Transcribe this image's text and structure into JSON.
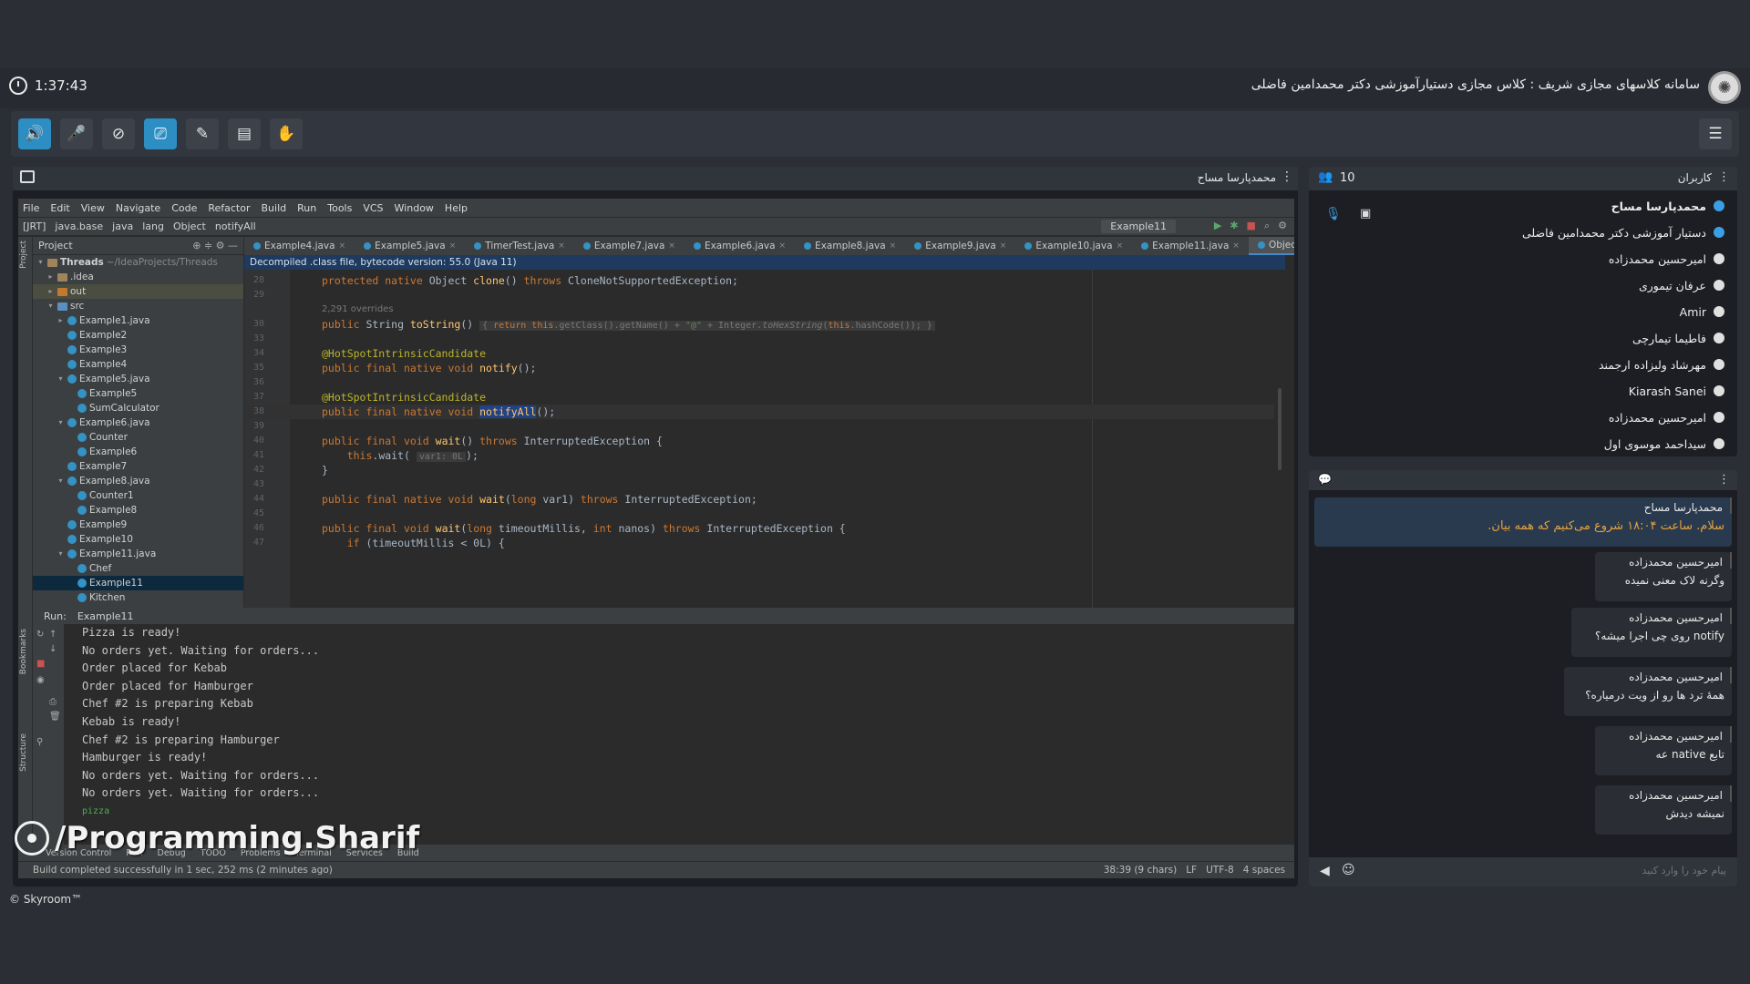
{
  "header": {
    "clock": "1:37:43",
    "room_title": "سامانه کلاسهای مجازی شریف : کلاس مجازی دستیارآموزشی دکتر محمدامین فاضلی"
  },
  "presenter": {
    "name": "محمدپارسا مساح"
  },
  "ide": {
    "menu": [
      "File",
      "Edit",
      "View",
      "Navigate",
      "Code",
      "Refactor",
      "Build",
      "Run",
      "Tools",
      "VCS",
      "Window",
      "Help"
    ],
    "breadcrumb": [
      "[JRT]",
      "java.base",
      "java",
      "lang",
      "Object",
      "notifyAll"
    ],
    "run_config": "Example11",
    "project_label": "Project",
    "tree": [
      {
        "label": "Threads",
        "extra": "~/IdeaProjects/Threads",
        "indent": 0,
        "arrow": "v",
        "icon": "fold"
      },
      {
        "label": ".idea",
        "indent": 1,
        "arrow": ">",
        "icon": "fold"
      },
      {
        "label": "out",
        "indent": 1,
        "arrow": ">",
        "icon": "fold-orange",
        "hl": true
      },
      {
        "label": "src",
        "indent": 1,
        "arrow": "v",
        "icon": "fold-blue"
      },
      {
        "label": "Example1.java",
        "indent": 2,
        "arrow": ">",
        "icon": "cls"
      },
      {
        "label": "Example2",
        "indent": 2,
        "arrow": "",
        "icon": "cls"
      },
      {
        "label": "Example3",
        "indent": 2,
        "arrow": "",
        "icon": "cls"
      },
      {
        "label": "Example4",
        "indent": 2,
        "arrow": "",
        "icon": "cls"
      },
      {
        "label": "Example5.java",
        "indent": 2,
        "arrow": "v",
        "icon": "cls"
      },
      {
        "label": "Example5",
        "indent": 3,
        "arrow": "",
        "icon": "cls"
      },
      {
        "label": "SumCalculator",
        "indent": 3,
        "arrow": "",
        "icon": "cls"
      },
      {
        "label": "Example6.java",
        "indent": 2,
        "arrow": "v",
        "icon": "cls"
      },
      {
        "label": "Counter",
        "indent": 3,
        "arrow": "",
        "icon": "cls"
      },
      {
        "label": "Example6",
        "indent": 3,
        "arrow": "",
        "icon": "cls"
      },
      {
        "label": "Example7",
        "indent": 2,
        "arrow": "",
        "icon": "cls"
      },
      {
        "label": "Example8.java",
        "indent": 2,
        "arrow": "v",
        "icon": "cls"
      },
      {
        "label": "Counter1",
        "indent": 3,
        "arrow": "",
        "icon": "cls"
      },
      {
        "label": "Example8",
        "indent": 3,
        "arrow": "",
        "icon": "cls"
      },
      {
        "label": "Example9",
        "indent": 2,
        "arrow": "",
        "icon": "cls"
      },
      {
        "label": "Example10",
        "indent": 2,
        "arrow": "",
        "icon": "cls"
      },
      {
        "label": "Example11.java",
        "indent": 2,
        "arrow": "v",
        "icon": "cls"
      },
      {
        "label": "Chef",
        "indent": 3,
        "arrow": "",
        "icon": "cls"
      },
      {
        "label": "Example11",
        "indent": 3,
        "arrow": "",
        "icon": "cls",
        "sel": true
      },
      {
        "label": "Kitchen",
        "indent": 3,
        "arrow": "",
        "icon": "cls"
      }
    ],
    "tabs": [
      "Example4.java",
      "Example5.java",
      "TimerTest.java",
      "Example7.java",
      "Example6.java",
      "Example8.java",
      "Example9.java",
      "Example10.java",
      "Example11.java",
      "Object.class"
    ],
    "active_tab": "Object.class",
    "banner": "Decompiled .class file, bytecode version: 55.0 (Java 11)",
    "overrides_hint": "2,291 overrides",
    "code_lines": [
      {
        "n": "28",
        "html": "<span class=\"kw\">protected native</span> Object <span class=\"fn\">clone</span>() <span class=\"kw\">throws</span> CloneNotSupportedException;"
      },
      {
        "n": "29",
        "html": ""
      },
      {
        "n": "30",
        "html": "<span class=\"kw\">public</span> String <span class=\"fn\">toString</span>() <span class=\"hint\">{ <span class=\"kw\">return this</span>.getClass().getName() + <span class=\"str\">\"@\"</span> + Integer.<span class=\"it\">toHexString</span>(<span class=\"kw\">this</span>.hashCode()); }</span>"
      },
      {
        "n": "33",
        "html": ""
      },
      {
        "n": "34",
        "html": "<span class=\"an\">@HotSpotIntrinsicCandidate</span>"
      },
      {
        "n": "35",
        "html": "<span class=\"kw\">public final native void</span> <span class=\"fn\">notify</span>();"
      },
      {
        "n": "36",
        "html": ""
      },
      {
        "n": "37",
        "html": "<span class=\"an\">@HotSpotIntrinsicCandidate</span>"
      },
      {
        "n": "38",
        "html": "<span class=\"kw\">public final native void</span> <span class=\"fn selw\">notifyAll</span>();"
      },
      {
        "n": "39",
        "html": ""
      },
      {
        "n": "40",
        "html": "<span class=\"kw\">public final void</span> <span class=\"fn\">wait</span>() <span class=\"kw\">throws</span> InterruptedException {"
      },
      {
        "n": "41",
        "html": "    <span class=\"kw\">this</span>.wait( <span class=\"hint\">var1: 0L</span>);"
      },
      {
        "n": "42",
        "html": "}"
      },
      {
        "n": "43",
        "html": ""
      },
      {
        "n": "44",
        "html": "<span class=\"kw\">public final native void</span> <span class=\"fn\">wait</span>(<span class=\"kw\">long</span> var1) <span class=\"kw\">throws</span> InterruptedException;"
      },
      {
        "n": "45",
        "html": ""
      },
      {
        "n": "46",
        "html": "<span class=\"kw\">public final void</span> <span class=\"fn\">wait</span>(<span class=\"kw\">long</span> timeoutMillis, <span class=\"kw\">int</span> nanos) <span class=\"kw\">throws</span> InterruptedException {"
      },
      {
        "n": "47",
        "html": "    <span class=\"kw\">if</span> (timeoutMillis < 0L) {"
      }
    ],
    "run_label": "Run:",
    "run_tab": "Example11",
    "console": [
      "Pizza is ready!",
      "No orders yet. Waiting for orders...",
      "Order placed for Kebab",
      "Order placed for Hamburger",
      "Chef #2 is preparing Kebab",
      "Kebab is ready!",
      "Chef #2 is preparing Hamburger",
      "Hamburger is ready!",
      "No orders yet. Waiting for orders...",
      "No orders yet. Waiting for orders..."
    ],
    "console_input": "pizza",
    "bottom_tools": [
      "Version Control",
      "Run",
      "Debug",
      "TODO",
      "Problems",
      "Terminal",
      "Services",
      "Build"
    ],
    "status_left": "Build completed successfully in 1 sec, 252 ms (2 minutes ago)",
    "status_right": [
      "38:39 (9 chars)",
      "LF",
      "UTF-8",
      "4 spaces"
    ]
  },
  "watermark": "/Programming.Sharif",
  "users": {
    "title": "کاربران",
    "count": "10",
    "list": [
      {
        "name": "محمدپارسا مساح",
        "bold": true,
        "blue": true
      },
      {
        "name": "دستیار آموزشی دکتر محمدامین فاضلی",
        "blue": true
      },
      {
        "name": "امیرحسین محمدزاده"
      },
      {
        "name": "عرفان تیموری"
      },
      {
        "name": "Amir"
      },
      {
        "name": "فاطیما تیمارچی"
      },
      {
        "name": "مهرشاد ولیزاده ارجمند"
      },
      {
        "name": "Kiarash Sanei"
      },
      {
        "name": "امیرحسین محمدزاده"
      },
      {
        "name": "سیداحمد موسوی اول"
      }
    ]
  },
  "chat": {
    "messages": [
      {
        "sender": "محمدپارسا مساح",
        "text": "سلام. ساعت ۱۸:۰۴ شروع می‌کنیم که همه بیان."
      },
      {
        "sender": "امیرحسین محمدزاده",
        "text": "وگرنه لاک معنی نمیده"
      },
      {
        "sender": "امیرحسین محمدزاده",
        "text": "notify روی چی اجرا میشه؟"
      },
      {
        "sender": "امیرحسین محمدزاده",
        "text": "همهٔ ترد ها رو از ویت درمیاره؟"
      },
      {
        "sender": "امیرحسین محمدزاده",
        "text": "تابع native عه"
      },
      {
        "sender": "امیرحسین محمدزاده",
        "text": "نمیشه دیدش"
      }
    ],
    "input_placeholder": "پیام خود را وارد کنید"
  },
  "footer": "© Skyroom™"
}
